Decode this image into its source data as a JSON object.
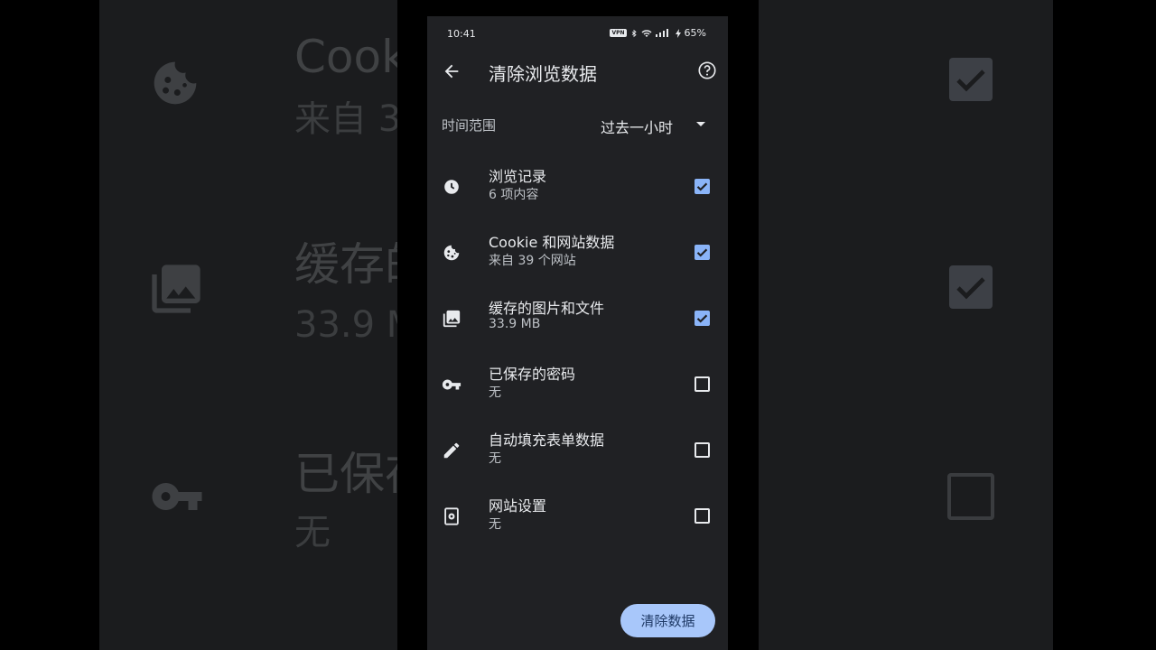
{
  "status": {
    "time": "10:41",
    "vpn": "VPN",
    "battery": "65%"
  },
  "app_bar": {
    "title": "清除浏览数据"
  },
  "time_range": {
    "label": "时间范围",
    "selected": "过去一小时"
  },
  "items": [
    {
      "icon": "history-clock-icon",
      "title": "浏览记录",
      "subtitle": "6 项内容",
      "checked": true
    },
    {
      "icon": "cookie-icon",
      "title": "Cookie 和网站数据",
      "subtitle": "来自 39 个网站",
      "checked": true
    },
    {
      "icon": "image-icon",
      "title": "缓存的图片和文件",
      "subtitle": "33.9 MB",
      "checked": true
    },
    {
      "icon": "key-icon",
      "title": "已保存的密码",
      "subtitle": "无",
      "checked": false
    },
    {
      "icon": "pencil-icon",
      "title": "自动填充表单数据",
      "subtitle": "无",
      "checked": false
    },
    {
      "icon": "site-settings-icon",
      "title": "网站设置",
      "subtitle": "无",
      "checked": false
    }
  ],
  "clear_button": {
    "label": "清除数据"
  },
  "background_zoom": {
    "row1_title": "Cook",
    "row1_sub": "来自 3",
    "row2_title": "缓存的",
    "row2_sub": "33.9 M",
    "row3_title": "已保存",
    "row3_sub": "无"
  },
  "colors": {
    "surface": "#202124",
    "accent": "#8ab4f8",
    "button": "#a8c7fa"
  }
}
